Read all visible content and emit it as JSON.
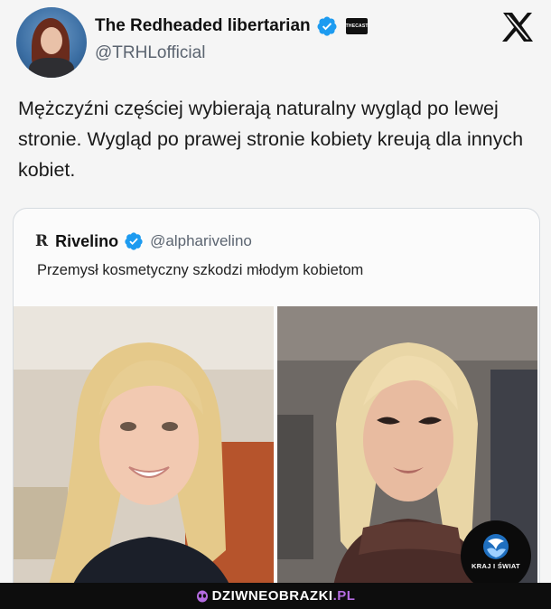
{
  "post": {
    "author_name": "The Redheaded libertarian",
    "affiliate_badge_text": "THECAST",
    "handle": "@TRHLofficial",
    "text": "Mężczyźni częściej wybierają naturalny wygląd po lewej stronie. Wygląd po prawej stronie kobiety kreują dla innych kobiet."
  },
  "quote": {
    "logo": "R",
    "name": "Rivelino",
    "handle": "@alpharivelino",
    "text": "Przemysł kosmetyczny szkodzi młodym kobietom"
  },
  "watermark": {
    "text": "KRAJ I ŚWIAT"
  },
  "footer": {
    "site_main": "DZIWNEOBRAZKI",
    "site_tld": ".PL"
  },
  "icons": {
    "verified": "verified-badge-icon",
    "platform": "x-logo-icon",
    "footer": "alien-icon"
  },
  "colors": {
    "verified": "#1d9bf0",
    "footer_bg": "#0d0d0d",
    "footer_accent": "#b46be0"
  }
}
